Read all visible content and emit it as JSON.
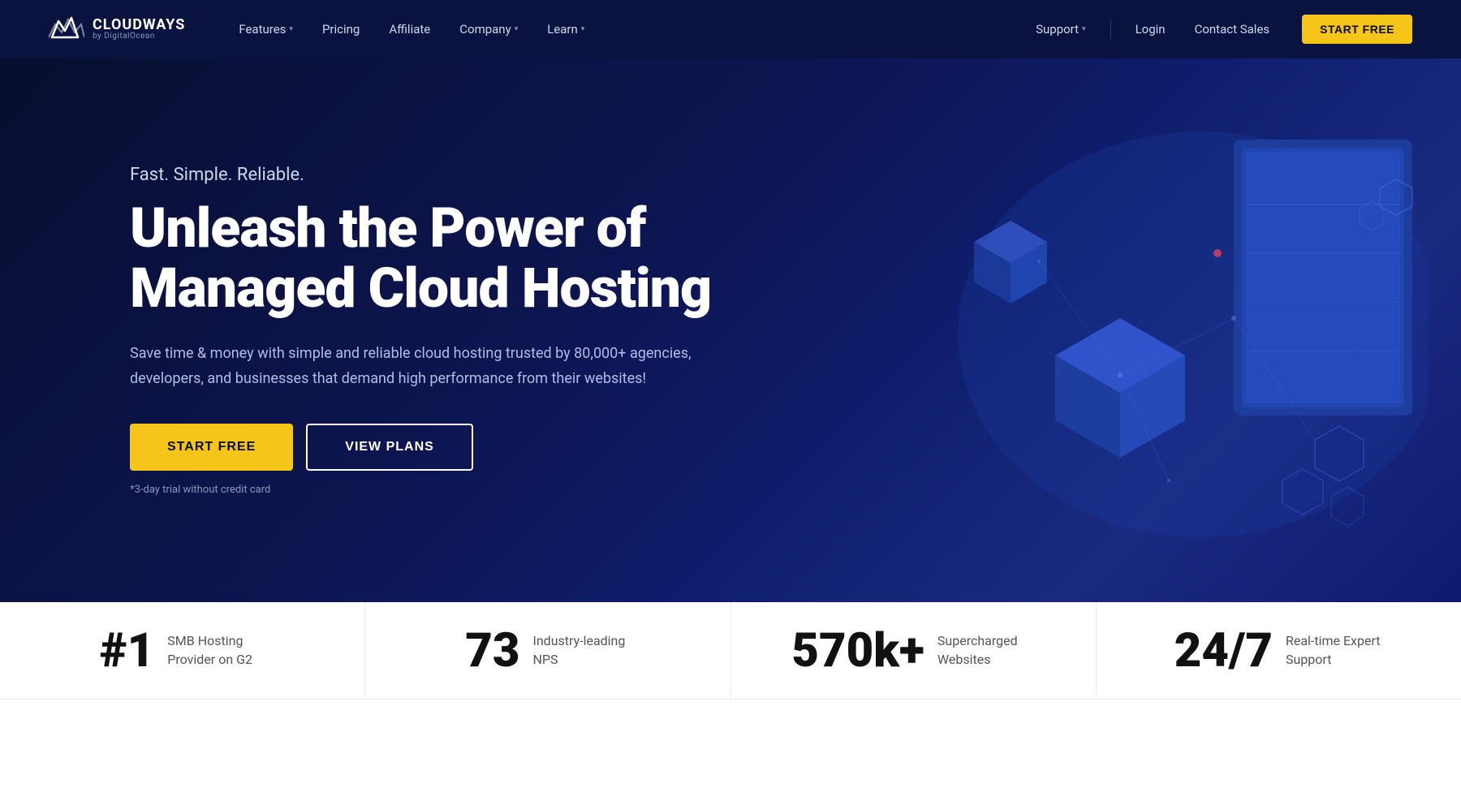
{
  "brand": {
    "name": "CLOUDWAYS",
    "sub": "by DigitalOcean"
  },
  "navbar": {
    "links": [
      {
        "label": "Features",
        "has_dropdown": true
      },
      {
        "label": "Pricing",
        "has_dropdown": false
      },
      {
        "label": "Affiliate",
        "has_dropdown": false
      },
      {
        "label": "Company",
        "has_dropdown": true
      },
      {
        "label": "Learn",
        "has_dropdown": true
      }
    ],
    "right_links": [
      {
        "label": "Support",
        "has_dropdown": true
      },
      {
        "label": "Login",
        "has_dropdown": false
      },
      {
        "label": "Contact Sales",
        "has_dropdown": false
      }
    ],
    "cta_label": "START FREE"
  },
  "hero": {
    "tagline": "Fast. Simple. Reliable.",
    "headline": "Unleash the Power of Managed Cloud Hosting",
    "description": "Save time & money with simple and reliable cloud hosting trusted by 80,000+ agencies, developers, and businesses that demand high performance from their websites!",
    "btn_start": "START FREE",
    "btn_plans": "VIEW PLANS",
    "note": "*3-day trial without credit card"
  },
  "stats": [
    {
      "number": "#1",
      "label": "SMB Hosting Provider on G2"
    },
    {
      "number": "73",
      "label": "Industry-leading NPS"
    },
    {
      "number": "570k+",
      "label": "Supercharged Websites"
    },
    {
      "number": "24/7",
      "label": "Real-time Expert Support"
    }
  ]
}
